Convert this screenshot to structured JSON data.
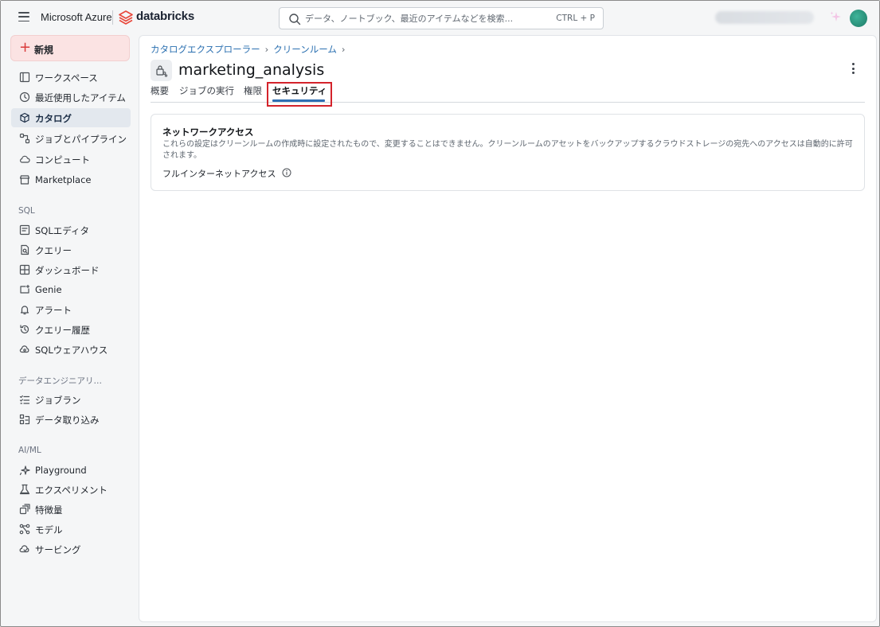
{
  "topbar": {
    "menu_icon": "hamburger-icon",
    "brand_microsoft": "Microsoft Azure",
    "brand_databricks": "databricks",
    "search_placeholder": "データ、ノートブック、最近のアイテムなどを検索...",
    "search_shortcut": "CTRL + P"
  },
  "sidebar": {
    "new_button": "新規",
    "items": [
      {
        "label": "ワークスペース",
        "icon": "workspace-icon"
      },
      {
        "label": "最近使用したアイテム",
        "icon": "clock-icon"
      },
      {
        "label": "カタログ",
        "icon": "catalog-icon",
        "active": true
      },
      {
        "label": "ジョブとパイプライン",
        "icon": "workflow-icon"
      },
      {
        "label": "コンピュート",
        "icon": "cloud-icon"
      },
      {
        "label": "Marketplace",
        "icon": "store-icon"
      }
    ],
    "sql_section": "SQL",
    "sql_items": [
      {
        "label": "SQLエディタ",
        "icon": "editor-icon"
      },
      {
        "label": "クエリー",
        "icon": "query-icon"
      },
      {
        "label": "ダッシュボード",
        "icon": "dashboard-icon"
      },
      {
        "label": "Genie",
        "icon": "genie-icon"
      },
      {
        "label": "アラート",
        "icon": "bell-icon"
      },
      {
        "label": "クエリー履歴",
        "icon": "history-icon"
      },
      {
        "label": "SQLウェアハウス",
        "icon": "warehouse-icon"
      }
    ],
    "de_section": "データエンジニアリング",
    "de_items": [
      {
        "label": "ジョブラン",
        "icon": "job-runs-icon"
      },
      {
        "label": "データ取り込み",
        "icon": "ingest-icon"
      }
    ],
    "ml_section": "AI/ML",
    "ml_items": [
      {
        "label": "Playground",
        "icon": "sparkle-icon"
      },
      {
        "label": "エクスペリメント",
        "icon": "flask-icon"
      },
      {
        "label": "特徴量",
        "icon": "feature-icon"
      },
      {
        "label": "モデル",
        "icon": "model-icon"
      },
      {
        "label": "サービング",
        "icon": "serving-icon"
      }
    ]
  },
  "main": {
    "breadcrumb": [
      "カタログエクスプローラー",
      "クリーンルーム"
    ],
    "title": "marketing_analysis",
    "tabs": [
      {
        "label": "概要"
      },
      {
        "label": "ジョブの実行"
      },
      {
        "label": "権限"
      },
      {
        "label": "セキュリティ",
        "active": true
      }
    ],
    "card": {
      "title": "ネットワークアクセス",
      "description": "これらの設定はクリーンルームの作成時に設定されたもので、変更することはできません。クリーンルームのアセットをバックアップするクラウドストレージの宛先へのアクセスは自動的に許可されます。",
      "setting": "フルインターネットアクセス"
    }
  },
  "colors": {
    "accent": "#2f6fb3",
    "new_button_bg": "#fbe3e3",
    "highlight_box": "#d4232b",
    "brand_red": "#e8473b"
  }
}
